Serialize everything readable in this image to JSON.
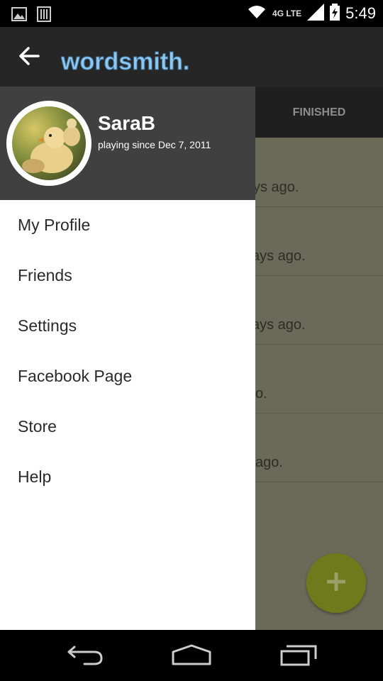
{
  "status_bar": {
    "time": "5:49",
    "network_label": "4G LTE",
    "icons": [
      "image-notification-icon",
      "barcode-notification-icon",
      "wifi-icon",
      "signal-icon",
      "battery-charging-icon"
    ]
  },
  "app_bar": {
    "title": "wordsmith.",
    "logo_color": "#8ec8f0"
  },
  "tabs": {
    "finished_label": "FINISHED"
  },
  "list_partial": [
    "ys ago.",
    "ays ago.",
    "ays ago.",
    "o.",
    "ago."
  ],
  "drawer": {
    "username": "SaraB",
    "since": "playing since Dec 7, 2011",
    "menu": [
      {
        "label": "My Profile"
      },
      {
        "label": "Friends"
      },
      {
        "label": "Settings"
      },
      {
        "label": "Facebook Page"
      },
      {
        "label": "Store"
      },
      {
        "label": "Help"
      }
    ]
  },
  "fab": {
    "icon": "plus-icon",
    "color": "#6f7a1d"
  },
  "nav_bar": {
    "icons": [
      "back-nav-icon",
      "home-nav-icon",
      "recents-nav-icon"
    ]
  }
}
